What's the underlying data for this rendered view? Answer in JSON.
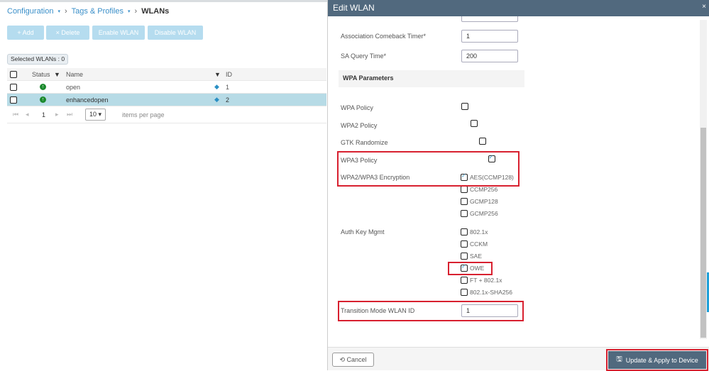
{
  "breadcrumb": {
    "item1": "Configuration",
    "item2": "Tags & Profiles",
    "current": "WLANs"
  },
  "toolbar": {
    "add": "+ Add",
    "delete": "× Delete",
    "enable": "Enable WLAN",
    "disable": "Disable WLAN"
  },
  "selected": "Selected WLANs : 0",
  "table": {
    "headers": {
      "status": "Status",
      "name": "Name",
      "id": "ID"
    },
    "rows": [
      {
        "name": "open",
        "id": "1",
        "status": "up"
      },
      {
        "name": "enhancedopen",
        "id": "2",
        "status": "up"
      }
    ]
  },
  "pager": {
    "page": "1",
    "per_page": "10 ▾",
    "per_page_label": "items per page"
  },
  "modal": {
    "title": "Edit WLAN",
    "close": "×",
    "assoc_label": "Association Comeback Timer*",
    "assoc_value": "1",
    "sa_label": "SA Query Time*",
    "sa_value": "200",
    "section": "WPA Parameters",
    "wpa_policy": "WPA Policy",
    "wpa2_policy": "WPA2 Policy",
    "gtk": "GTK Randomize",
    "wpa3_policy": "WPA3 Policy",
    "encryption": "WPA2/WPA3 Encryption",
    "enc_options": [
      "AES(CCMP128)",
      "CCMP256",
      "GCMP128",
      "GCMP256"
    ],
    "akm": "Auth Key Mgmt",
    "akm_options": [
      "802.1x",
      "CCKM",
      "SAE",
      "OWE",
      "FT + 802.1x",
      "802.1x-SHA256"
    ],
    "transition_label": "Transition Mode WLAN ID",
    "transition_value": "1",
    "cancel": "⟲ Cancel",
    "apply": "Update & Apply to Device"
  }
}
